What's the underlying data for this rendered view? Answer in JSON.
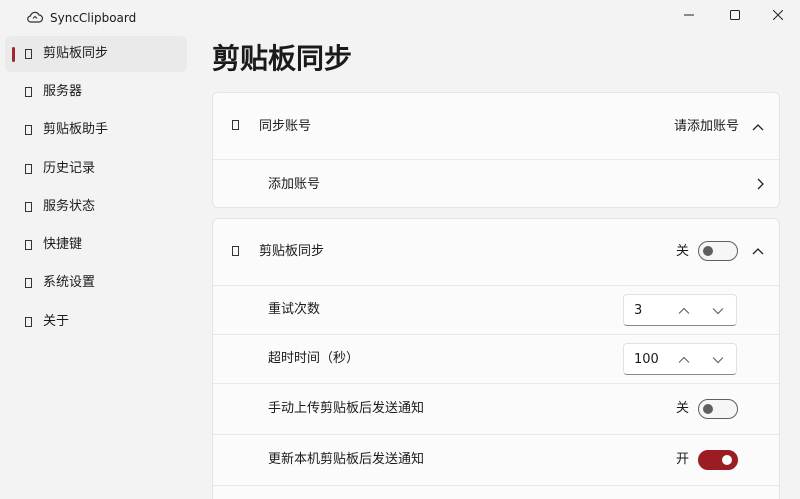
{
  "app": {
    "title": "SyncClipboard"
  },
  "window": {
    "minimize": "minimize",
    "maximize": "maximize",
    "close": "close"
  },
  "sidebar": {
    "items": [
      {
        "label": "剪贴板同步",
        "selected": true
      },
      {
        "label": "服务器"
      },
      {
        "label": "剪贴板助手"
      },
      {
        "label": "历史记录"
      },
      {
        "label": "服务状态"
      },
      {
        "label": "快捷键"
      },
      {
        "label": "系统设置"
      },
      {
        "label": "关于"
      }
    ]
  },
  "page": {
    "title": "剪贴板同步"
  },
  "account_card": {
    "header": {
      "label": "同步账号",
      "value": "请添加账号"
    },
    "add_account": {
      "label": "添加账号"
    }
  },
  "sync_card": {
    "header": {
      "label": "剪贴板同步",
      "toggle_text": "关",
      "toggle_on": false
    },
    "retry": {
      "label": "重试次数",
      "value": "3"
    },
    "timeout": {
      "label": "超时时间（秒）",
      "value": "100"
    },
    "manual_notify": {
      "label": "手动上传剪贴板后发送通知",
      "toggle_text": "关",
      "toggle_on": false
    },
    "local_notify": {
      "label": "更新本机剪贴板后发送通知",
      "toggle_text": "开",
      "toggle_on": true
    }
  },
  "colors": {
    "accent": "#9b1c22",
    "background": "#f3f3f3",
    "card": "#fbfbfb"
  }
}
